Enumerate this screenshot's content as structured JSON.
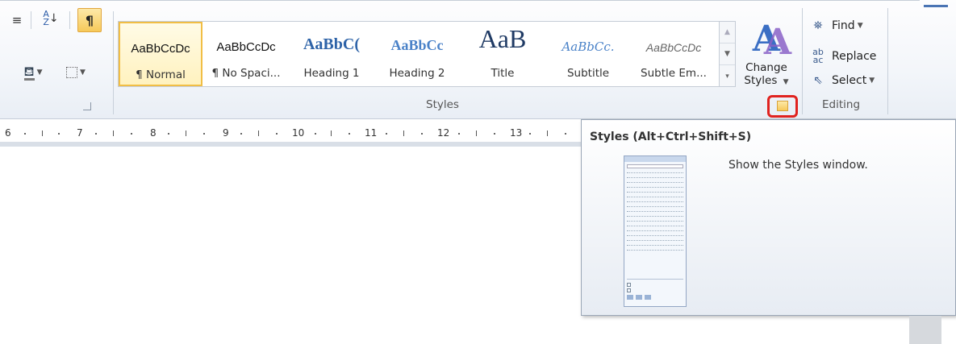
{
  "ribbon": {
    "paragraph": {
      "sort_icon": "sort-az-icon",
      "pilcrow_label": "¶",
      "shading_icon": "paint-bucket-icon",
      "borders_icon": "borders-icon"
    },
    "styles": {
      "gallery": [
        {
          "sample": "AaBbCcDc",
          "name": "¶ Normal"
        },
        {
          "sample": "AaBbCcDc",
          "name": "¶ No Spaci..."
        },
        {
          "sample": "AaBbC(",
          "name": "Heading 1"
        },
        {
          "sample": "AaBbCc",
          "name": "Heading 2"
        },
        {
          "sample": "AaB",
          "name": "Title"
        },
        {
          "sample": "AaBbCc.",
          "name": "Subtitle"
        },
        {
          "sample": "AaBbCcDc",
          "name": "Subtle Em..."
        }
      ],
      "change_styles_label": "Change Styles",
      "group_label": "Styles"
    },
    "editing": {
      "find_label": "Find",
      "replace_label": "Replace",
      "select_label": "Select",
      "group_label": "Editing"
    }
  },
  "ruler": {
    "numbers": [
      "6",
      "7",
      "8",
      "9",
      "10",
      "11",
      "12",
      "13"
    ]
  },
  "tooltip": {
    "title": "Styles (Alt+Ctrl+Shift+S)",
    "description": "Show the Styles window."
  },
  "colors": {
    "accent_red": "#e0221f",
    "selected_gold": "#f1be45",
    "heading_blue": "#2e63a8"
  }
}
